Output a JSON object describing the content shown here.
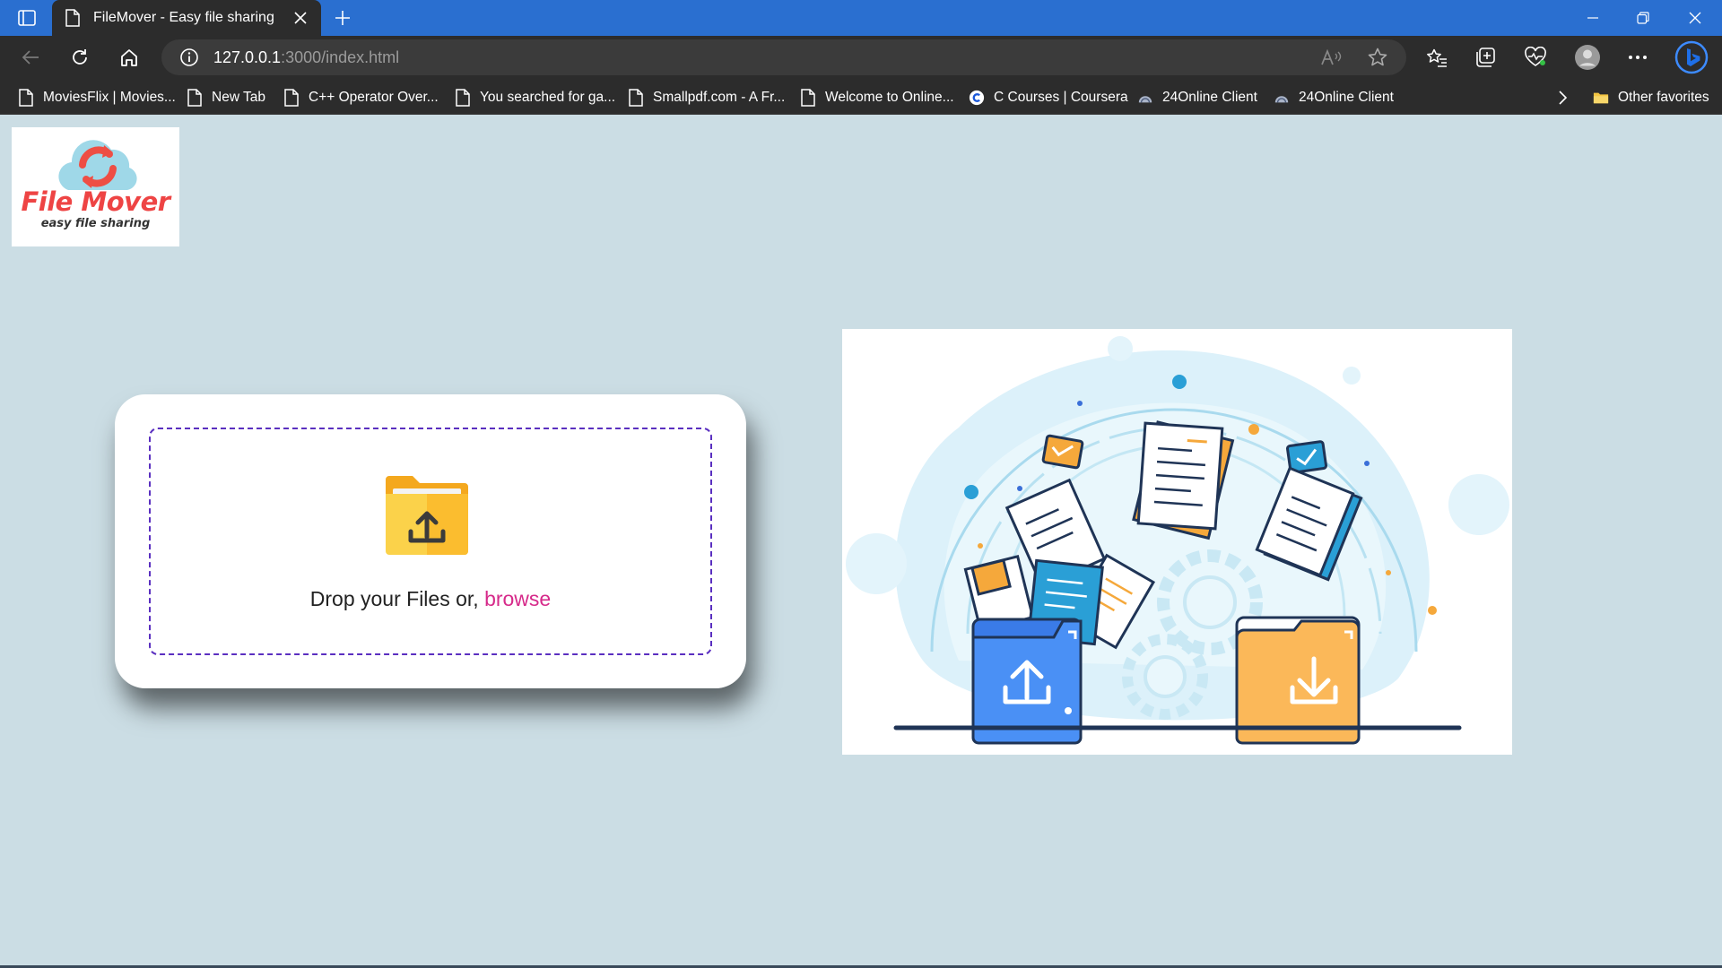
{
  "browser": {
    "tab_title": "FileMover - Easy file sharing",
    "url_host": "127.0.0.1",
    "url_rest": ":3000/index.html",
    "bookmarks": [
      {
        "label": "MoviesFlix | Movies...",
        "icon": "page-icon"
      },
      {
        "label": "New Tab",
        "icon": "page-icon"
      },
      {
        "label": "C++ Operator Over...",
        "icon": "page-icon"
      },
      {
        "label": "You searched for ga...",
        "icon": "page-icon"
      },
      {
        "label": "Smallpdf.com - A Fr...",
        "icon": "page-icon"
      },
      {
        "label": "Welcome to Online...",
        "icon": "page-icon"
      },
      {
        "label": "C Courses | Coursera",
        "icon": "coursera-icon"
      },
      {
        "label": "24Online Client",
        "icon": "cloud-icon"
      },
      {
        "label": "24Online Client",
        "icon": "cloud-icon"
      }
    ],
    "other_favorites": "Other favorites"
  },
  "logo": {
    "title": "File Mover",
    "subtitle": "easy file sharing"
  },
  "upload": {
    "prompt": "Drop your Files or, ",
    "browse_label": "browse"
  },
  "colors": {
    "page_background": "#cbdde4",
    "accent_browse": "#d62a8a",
    "dropzone_border": "#5a2fc0",
    "titlebar": "#2a6fd0"
  }
}
